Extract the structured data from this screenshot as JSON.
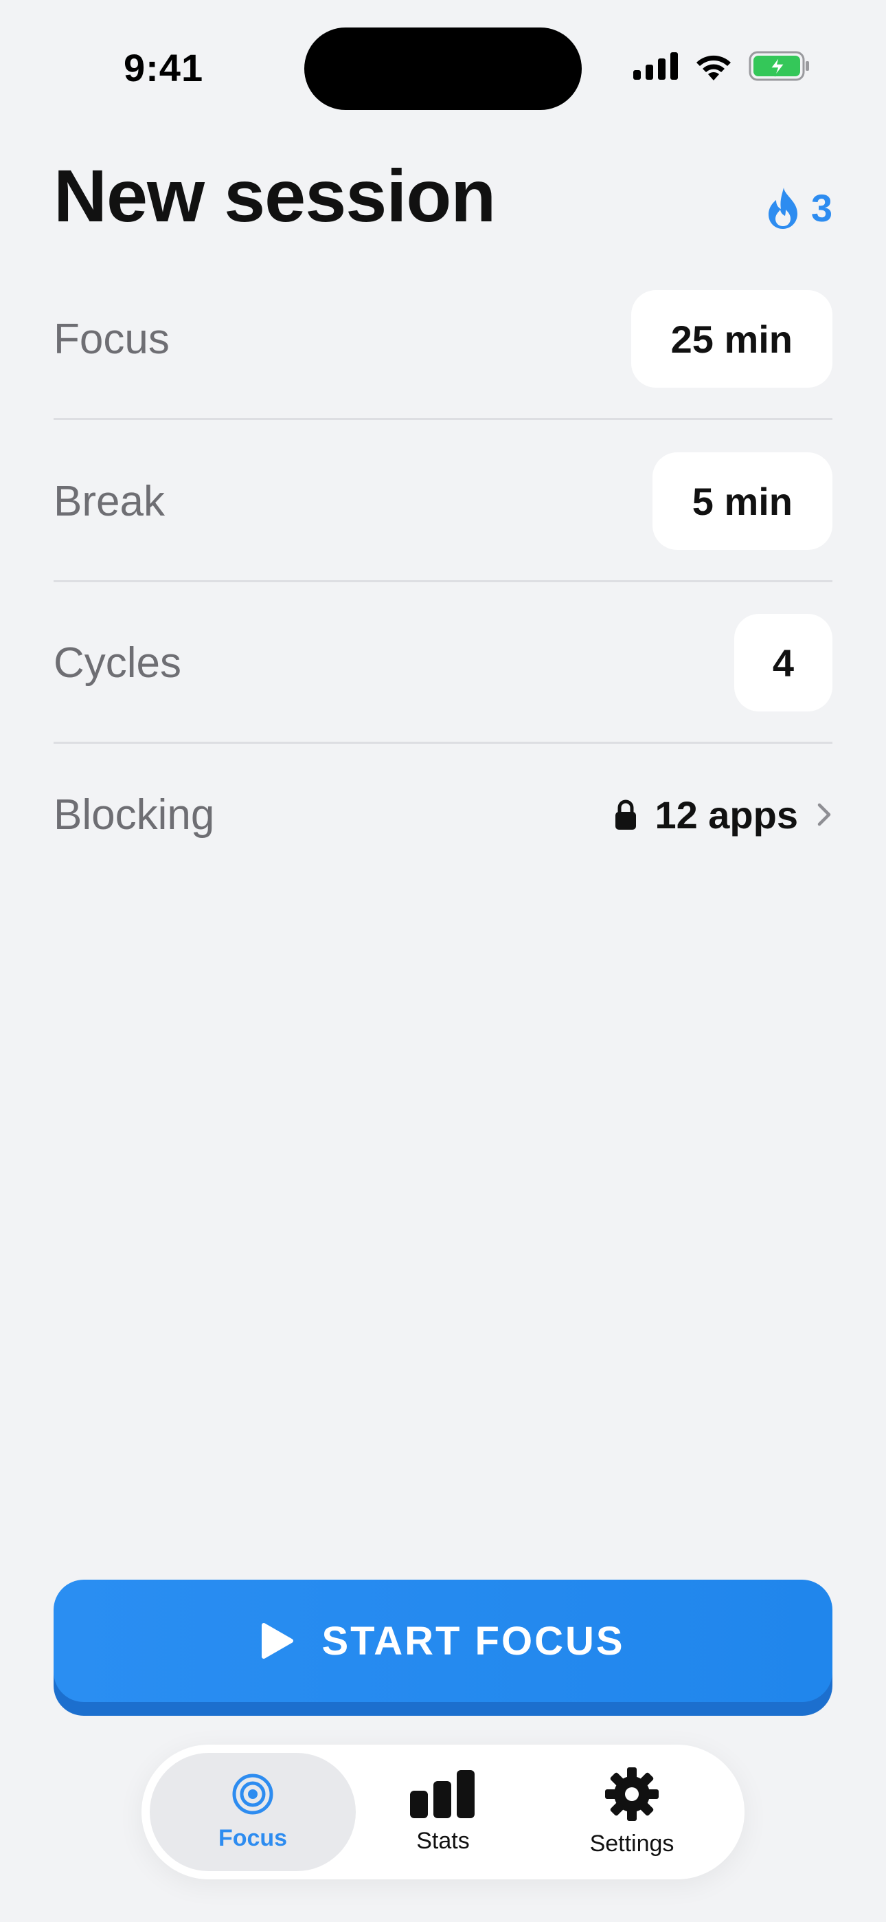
{
  "status_bar": {
    "time": "9:41"
  },
  "header": {
    "title": "New session",
    "streak_count": "3"
  },
  "settings": {
    "focus": {
      "label": "Focus",
      "value": "25 min"
    },
    "break": {
      "label": "Break",
      "value": "5 min"
    },
    "cycles": {
      "label": "Cycles",
      "value": "4"
    },
    "blocking": {
      "label": "Blocking",
      "value": "12 apps"
    }
  },
  "start_button": {
    "label": "START FOCUS"
  },
  "tabs": [
    {
      "label": "Focus",
      "icon": "target-icon",
      "active": true
    },
    {
      "label": "Stats",
      "icon": "bar-chart-icon",
      "active": false
    },
    {
      "label": "Settings",
      "icon": "gear-icon",
      "active": false
    }
  ],
  "colors": {
    "accent": "#2D8CF0",
    "background": "#F2F3F5",
    "battery": "#34C759"
  }
}
